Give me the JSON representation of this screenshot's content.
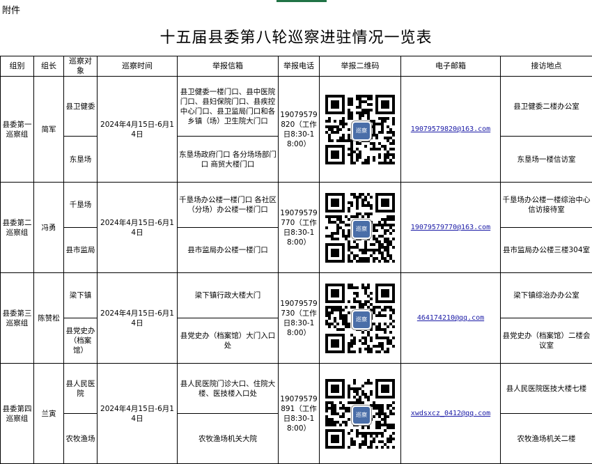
{
  "attachment_label": "附件",
  "title": "十五届县委第八轮巡察进驻情况一览表",
  "headers": [
    "组别",
    "组长",
    "巡察对象",
    "巡察时间",
    "举报信箱",
    "举报电话",
    "举报二维码",
    "电子邮箱",
    "接访地点"
  ],
  "qr_badge": "巡察",
  "groups": [
    {
      "name": "县委第一巡察组",
      "leader": "简军",
      "time": "2024年4月15日-6月14日",
      "phone": "19079579820（工作日8:30-18:00）",
      "email": "19079579820@163.com",
      "targets": [
        {
          "name": "县卫健委",
          "mailbox": "县卫健委一楼门口、县中医院门口、县妇保院门口、县疾控中心门口、县卫监局门口和各乡镇（场）卫生院大门口",
          "location": "县卫健委二楼办公室"
        },
        {
          "name": "东垦场",
          "mailbox": "东垦场政府门口 各分场场部门口 商贸大楼门口",
          "location": "东垦场一楼信访室"
        }
      ]
    },
    {
      "name": "县委第二巡察组",
      "leader": "冯勇",
      "time": "2024年4月15日-6月14日",
      "phone": "19079579770（工作日8:30-18:00）",
      "email": "19079579770@163.com",
      "targets": [
        {
          "name": "千垦场",
          "mailbox": "千垦场办公楼一楼门口 各社区（分场）办公楼一楼门口",
          "location": "千垦场办公楼一楼综治中心信访接待室"
        },
        {
          "name": "县市监局",
          "mailbox": "县市监局办公楼一楼门口",
          "location": "县市监局办公楼三楼304室"
        }
      ]
    },
    {
      "name": "县委第三巡察组",
      "leader": "陈赞松",
      "time": "2024年4月15日-6月14日",
      "phone": "19079579730（工作日8:30-18:00）",
      "email": "464174210@qq.com",
      "targets": [
        {
          "name": "梁下镇",
          "mailbox": "梁下镇行政大楼大门",
          "location": "梁下镇综治办办公室"
        },
        {
          "name": "县党史办（档案馆）",
          "mailbox": "县党史办（档案馆）大门入口处",
          "location": "县党史办（档案馆）二楼会议室"
        }
      ]
    },
    {
      "name": "县委第四巡察组",
      "leader": "兰寅",
      "time": "2024年4月15日-6月14日",
      "phone": "19079579891（工作日8:30-18:00）",
      "email": "xwdsxcz_0412@qq.com",
      "targets": [
        {
          "name": "县人民医院",
          "mailbox": "县人民医院门诊大口、住院大楼、医技楼入口处",
          "location": "县人民医院医技大楼七楼"
        },
        {
          "name": "农牧渔场",
          "mailbox": "农牧渔场机关大院",
          "location": "农牧渔场机关二楼"
        }
      ]
    }
  ]
}
